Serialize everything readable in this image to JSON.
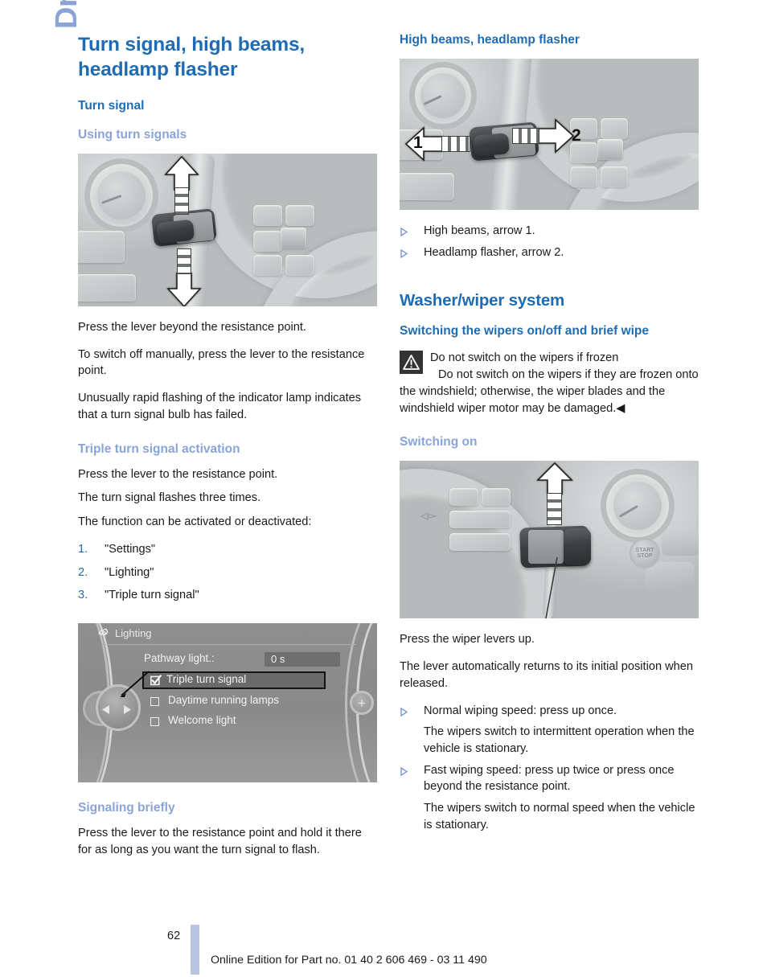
{
  "chapter_tab": {
    "label": "Driving"
  },
  "left_column": {
    "chapter_title": "Turn signal, high beams, headlamp flasher",
    "section_title": "Turn signal",
    "subsection_title": "Using turn signals",
    "figure_turn_signal": {
      "caption_alt": "Steering column turn signal lever with up and down arrows"
    },
    "paragraphs": [
      "Press the lever beyond the resistance point.",
      "To switch off manually, press the lever to the resistance point.",
      "Unusually rapid flashing of the indicator lamp indicates that a turn signal bulb has failed."
    ],
    "triple_heading": "Triple turn signal activation",
    "triple_paragraphs": [
      "Press the lever to the resistance point.",
      "The turn signal flashes three times.",
      "The function can be activated or deactivated:"
    ],
    "numbered_list": [
      {
        "num": "1.",
        "label": "\"Settings\""
      },
      {
        "num": "2.",
        "label": "\"Lighting\""
      },
      {
        "num": "3.",
        "label": "\"Triple turn signal\""
      }
    ],
    "idrive_screen": {
      "title": "Lighting",
      "rows": [
        {
          "label": "Pathway light.:",
          "value": "0 s",
          "type": "value"
        },
        {
          "label": "Triple turn signal",
          "checked": true,
          "selected": true,
          "type": "checkbox"
        },
        {
          "label": "Daytime running lamps",
          "checked": false,
          "selected": false,
          "type": "checkbox"
        },
        {
          "label": "Welcome light",
          "checked": false,
          "selected": false,
          "type": "checkbox"
        }
      ],
      "plus_button": "+"
    },
    "signaling_heading": "Signaling briefly",
    "signaling_text": "Press the lever to the resistance point and hold it there for as long as you want the turn signal to flash."
  },
  "right_column": {
    "highbeams_heading": "High beams, headlamp flasher",
    "figure_highbeams": {
      "caption_alt": "Steering column lever with arrows 1 and 2",
      "arrow_1": "1",
      "arrow_2": "2"
    },
    "highbeams_bullets": [
      "High beams, arrow 1.",
      "Headlamp flasher, arrow 2."
    ],
    "washer_heading": "Washer/wiper system",
    "switching_heading": "Switching the wipers on/off and brief wipe",
    "warning": {
      "icon": "warning-triangle-icon",
      "title": "Do not switch on the wipers if frozen",
      "body": "Do not switch on the wipers if they are frozen onto the windshield; otherwise, the wiper blades and the windshield wiper motor may be damaged.◀"
    },
    "switching_on_heading": "Switching on",
    "figure_wipers": {
      "caption_alt": "Wiper lever with upward arrow near START STOP button",
      "start_stop_label": "START STOP"
    },
    "wiper_paragraphs": [
      "Press the wiper levers up.",
      "The lever automatically returns to its initial position when released."
    ],
    "wiper_bullets": [
      {
        "main": "Normal wiping speed: press up once.",
        "cont": "The wipers switch to intermittent operation when the vehicle is stationary."
      },
      {
        "main": "Fast wiping speed: press up twice or press once beyond the resistance point.",
        "cont": "The wipers switch to normal speed when the vehicle is stationary."
      }
    ]
  },
  "footer": {
    "page_number": "62",
    "edition_text": "Online Edition for Part no. 01 40 2 606 469 - 03 11 490"
  },
  "colors": {
    "heading_blue": "#1f6cb5",
    "light_blue": "#8aa4d8",
    "footer_bar": "#b7c4e2",
    "body_text": "#1a1a1a"
  }
}
